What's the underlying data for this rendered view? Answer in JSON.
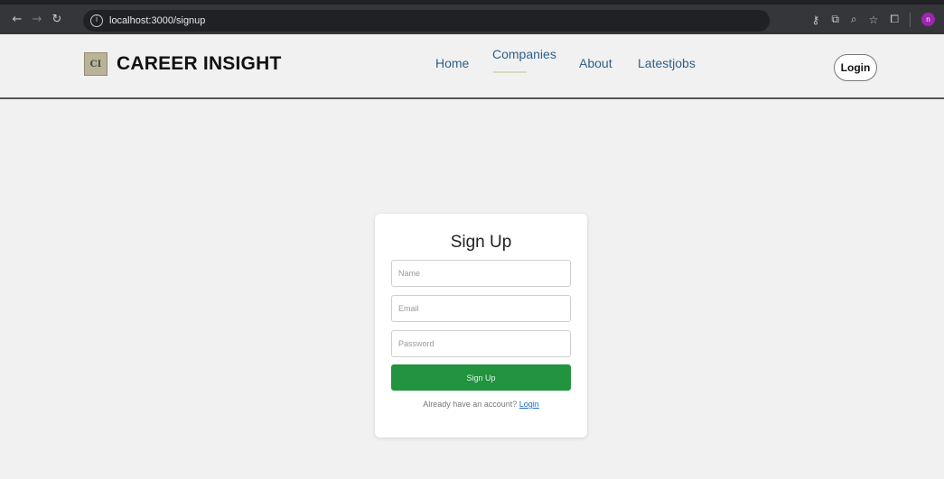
{
  "browser": {
    "url": "localhost:3000/signup",
    "avatar_letter": "n",
    "avatar_color": "#9c27b0"
  },
  "header": {
    "brand_name": "CAREER INSIGHT",
    "logo_text": "CI",
    "nav": {
      "home": "Home",
      "companies": "Companies",
      "about": "About",
      "latestjobs": "Latestjobs"
    },
    "active_nav": "Companies",
    "login_label": "Login"
  },
  "signup": {
    "title": "Sign Up",
    "name_placeholder": "Name",
    "email_placeholder": "Email",
    "password_placeholder": "Password",
    "button_label": "Sign Up",
    "already_text": "Already have an account?",
    "login_link": "Login",
    "button_color": "#22933f"
  }
}
